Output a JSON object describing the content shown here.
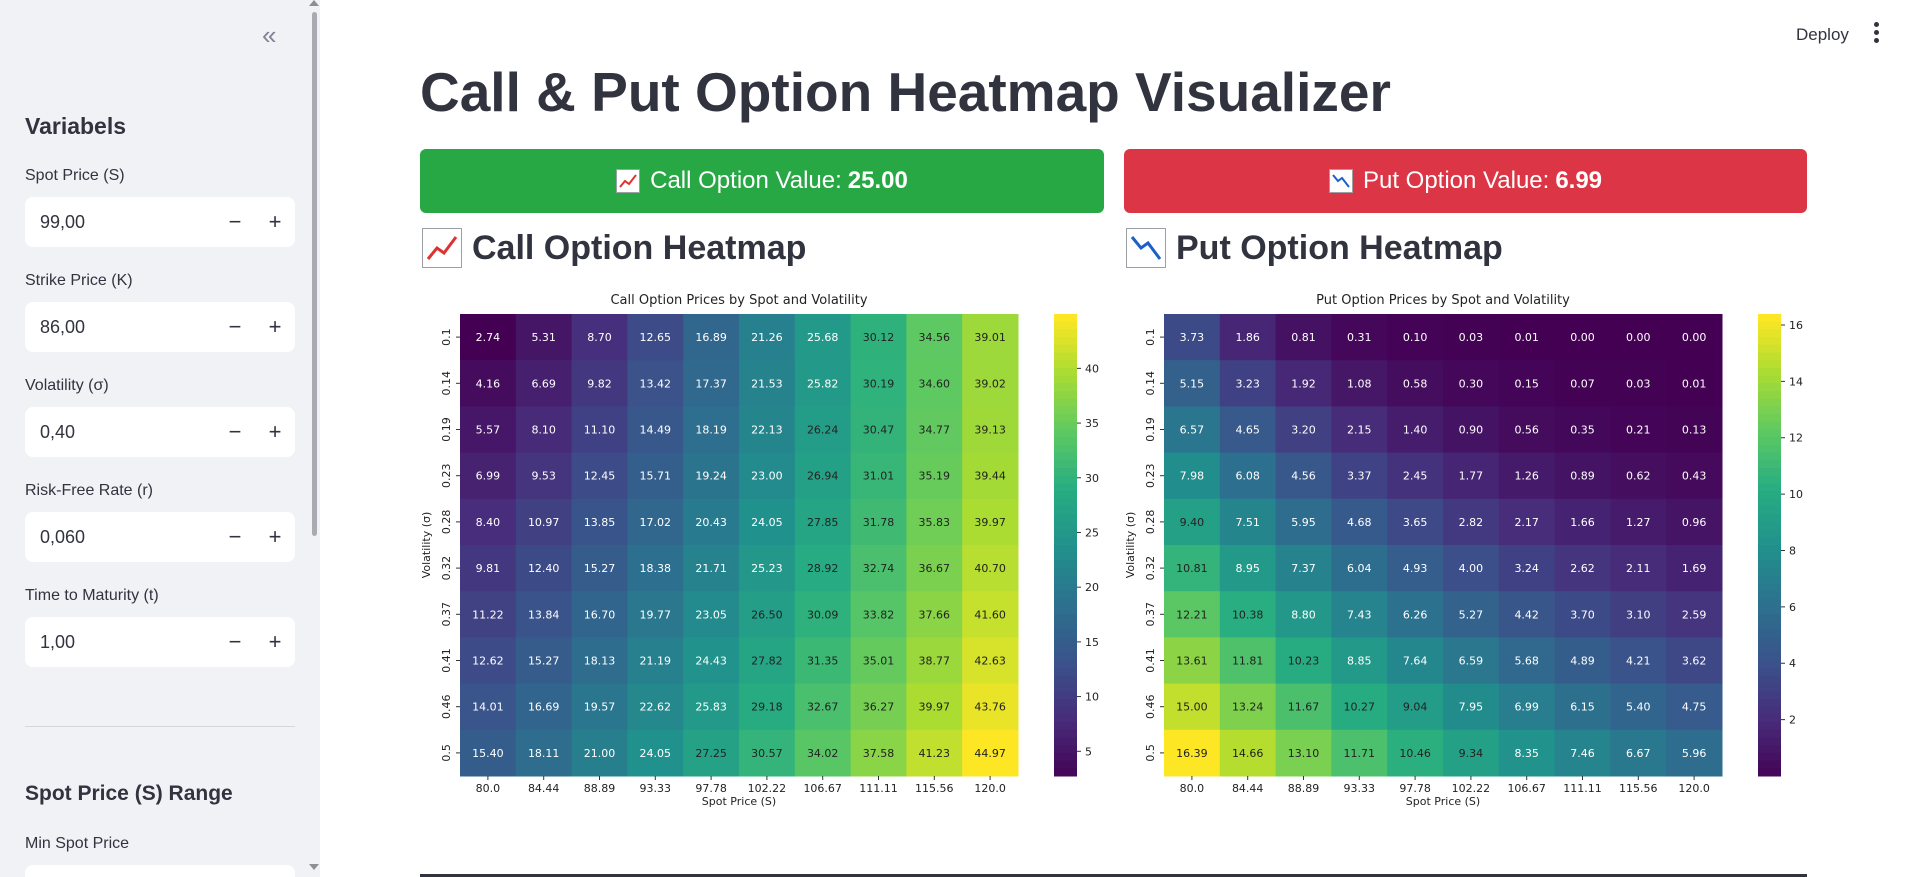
{
  "sidebar": {
    "collapse_icon": "«",
    "heading": "Variabels",
    "inputs": [
      {
        "label": "Spot Price (S)",
        "value": "99,00"
      },
      {
        "label": "Strike Price (K)",
        "value": "86,00"
      },
      {
        "label": "Volatility (σ)",
        "value": "0,40"
      },
      {
        "label": "Risk-Free Rate (r)",
        "value": "0,060"
      },
      {
        "label": "Time to Maturity (t)",
        "value": "1,00"
      }
    ],
    "minus": "−",
    "plus": "+",
    "range_heading": "Spot Price (S) Range",
    "min_spot_label": "Min Spot Price"
  },
  "header": {
    "deploy": "Deploy"
  },
  "main": {
    "title": "Call & Put Option Heatmap Visualizer",
    "call_value_label": "Call Option Value:",
    "call_value": "25.00",
    "put_value_label": "Put Option Value:",
    "put_value": "6.99",
    "call_heading": "Call Option Heatmap",
    "put_heading": "Put Option Heatmap"
  },
  "colors": {
    "call_green": "#28a745",
    "put_red": "#dc3545",
    "sidebar_bg": "#f0f2f6",
    "text": "#31333f",
    "colormap": "viridis"
  },
  "chart_data": [
    {
      "type": "heatmap",
      "title": "Call Option Prices by Spot and Volatility",
      "xlabel": "Spot Price (S)",
      "ylabel": "Volatility (σ)",
      "x": [
        "80.0",
        "84.44",
        "88.89",
        "93.33",
        "97.78",
        "102.22",
        "106.67",
        "111.11",
        "115.56",
        "120.0"
      ],
      "y": [
        "0.1",
        "0.14",
        "0.19",
        "0.23",
        "0.28",
        "0.32",
        "0.37",
        "0.41",
        "0.46",
        "0.5"
      ],
      "values": [
        [
          2.74,
          5.31,
          8.7,
          12.65,
          16.89,
          21.26,
          25.68,
          30.12,
          34.56,
          39.01
        ],
        [
          4.16,
          6.69,
          9.82,
          13.42,
          17.37,
          21.53,
          25.82,
          30.19,
          34.6,
          39.02
        ],
        [
          5.57,
          8.1,
          11.1,
          14.49,
          18.19,
          22.13,
          26.24,
          30.47,
          34.77,
          39.13
        ],
        [
          6.99,
          9.53,
          12.45,
          15.71,
          19.24,
          23.0,
          26.94,
          31.01,
          35.19,
          39.44
        ],
        [
          8.4,
          10.97,
          13.85,
          17.02,
          20.43,
          24.05,
          27.85,
          31.78,
          35.83,
          39.97
        ],
        [
          9.81,
          12.4,
          15.27,
          18.38,
          21.71,
          25.23,
          28.92,
          32.74,
          36.67,
          40.7
        ],
        [
          11.22,
          13.84,
          16.7,
          19.77,
          23.05,
          26.5,
          30.09,
          33.82,
          37.66,
          41.6
        ],
        [
          12.62,
          15.27,
          18.13,
          21.19,
          24.43,
          27.82,
          31.35,
          35.01,
          38.77,
          42.63
        ],
        [
          14.01,
          16.69,
          19.57,
          22.62,
          25.83,
          29.18,
          32.67,
          36.27,
          39.97,
          43.76
        ],
        [
          15.4,
          18.11,
          21.0,
          24.05,
          27.25,
          30.57,
          34.02,
          37.58,
          41.23,
          44.97
        ]
      ],
      "colorbar_ticks": [
        5,
        10,
        15,
        20,
        25,
        30,
        35,
        40
      ],
      "vmin": 2.74,
      "vmax": 44.97
    },
    {
      "type": "heatmap",
      "title": "Put Option Prices by Spot and Volatility",
      "xlabel": "Spot Price (S)",
      "ylabel": "Volatility (σ)",
      "x": [
        "80.0",
        "84.44",
        "88.89",
        "93.33",
        "97.78",
        "102.22",
        "106.67",
        "111.11",
        "115.56",
        "120.0"
      ],
      "y": [
        "0.1",
        "0.14",
        "0.19",
        "0.23",
        "0.28",
        "0.32",
        "0.37",
        "0.41",
        "0.46",
        "0.5"
      ],
      "values": [
        [
          3.73,
          1.86,
          0.81,
          0.31,
          0.1,
          0.03,
          0.01,
          0.0,
          0.0,
          0.0
        ],
        [
          5.15,
          3.23,
          1.92,
          1.08,
          0.58,
          0.3,
          0.15,
          0.07,
          0.03,
          0.01
        ],
        [
          6.57,
          4.65,
          3.2,
          2.15,
          1.4,
          0.9,
          0.56,
          0.35,
          0.21,
          0.13
        ],
        [
          7.98,
          6.08,
          4.56,
          3.37,
          2.45,
          1.77,
          1.26,
          0.89,
          0.62,
          0.43
        ],
        [
          9.4,
          7.51,
          5.95,
          4.68,
          3.65,
          2.82,
          2.17,
          1.66,
          1.27,
          0.96
        ],
        [
          10.81,
          8.95,
          7.37,
          6.04,
          4.93,
          4.0,
          3.24,
          2.62,
          2.11,
          1.69
        ],
        [
          12.21,
          10.38,
          8.8,
          7.43,
          6.26,
          5.27,
          4.42,
          3.7,
          3.1,
          2.59
        ],
        [
          13.61,
          11.81,
          10.23,
          8.85,
          7.64,
          6.59,
          5.68,
          4.89,
          4.21,
          3.62
        ],
        [
          15.0,
          13.24,
          11.67,
          10.27,
          9.04,
          7.95,
          6.99,
          6.15,
          5.4,
          4.75
        ],
        [
          16.39,
          14.66,
          13.1,
          11.71,
          10.46,
          9.34,
          8.35,
          7.46,
          6.67,
          5.96
        ]
      ],
      "colorbar_ticks": [
        2,
        4,
        6,
        8,
        10,
        12,
        14,
        16
      ],
      "vmin": 0.0,
      "vmax": 16.39
    }
  ]
}
